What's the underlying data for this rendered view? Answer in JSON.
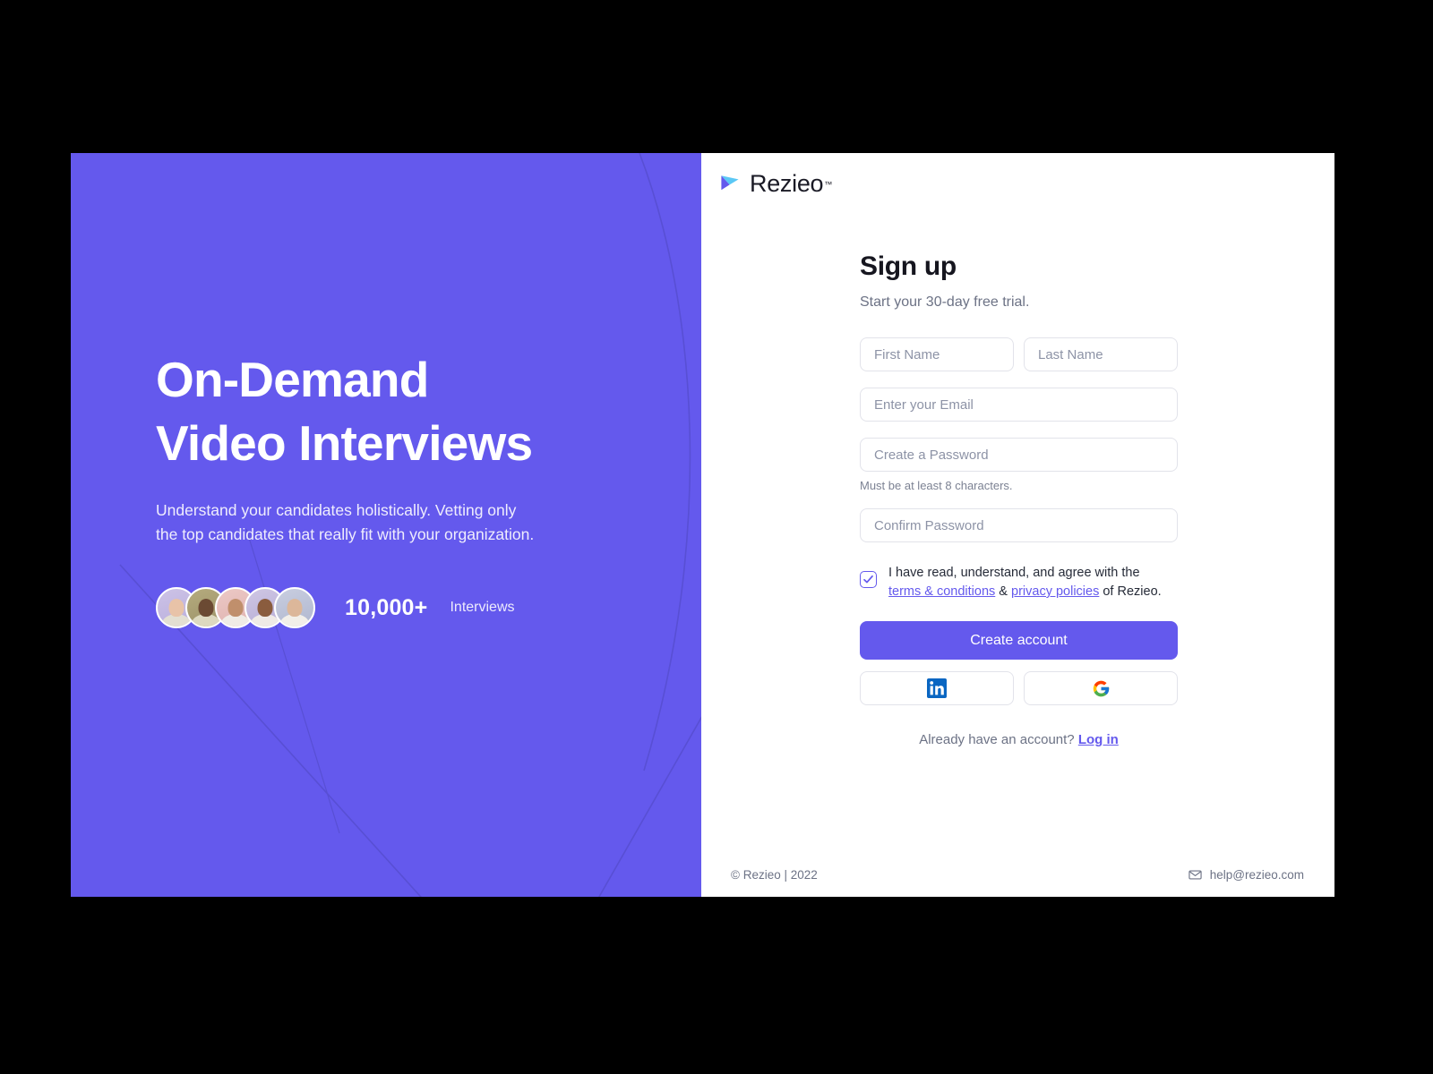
{
  "brand": {
    "name": "Rezieo",
    "trademark": "™",
    "logo_icon": "play-mark-icon",
    "accent_purple": "#6459ED",
    "accent_cyan": "#5BC8F5"
  },
  "promo": {
    "title": "On-Demand\nVideo Interviews",
    "subtitle": "Understand your candidates holistically. Vetting only\nthe top candidates that really fit with your organization.",
    "stat_number": "10,000+",
    "stat_label": "Interviews",
    "avatar_count": 5,
    "background_color": "#6459ED"
  },
  "form": {
    "heading": "Sign up",
    "subheading": "Start your 30-day free trial.",
    "first_name": {
      "placeholder": "First Name",
      "value": ""
    },
    "last_name": {
      "placeholder": "Last Name",
      "value": ""
    },
    "email": {
      "placeholder": "Enter your Email",
      "value": ""
    },
    "password": {
      "placeholder": "Create a Password",
      "value": ""
    },
    "password_hint": "Must be at least 8 characters.",
    "confirm_password": {
      "placeholder": "Confirm Password",
      "value": ""
    },
    "terms": {
      "checked": true,
      "line1": "I have read, understand, and agree with the",
      "link_terms": "terms & conditions",
      "between": " & ",
      "link_privacy": "privacy policies",
      "tail": " of Rezieo."
    },
    "submit_label": "Create account",
    "social": [
      {
        "name": "linkedin",
        "icon": "linkedin-icon"
      },
      {
        "name": "google",
        "icon": "google-icon"
      }
    ],
    "login_prompt": "Already have an account?",
    "login_label": "Log in"
  },
  "footer": {
    "copyright": "© Rezieo | 2022",
    "email": "help@rezieo.com",
    "email_icon": "envelope-icon"
  }
}
